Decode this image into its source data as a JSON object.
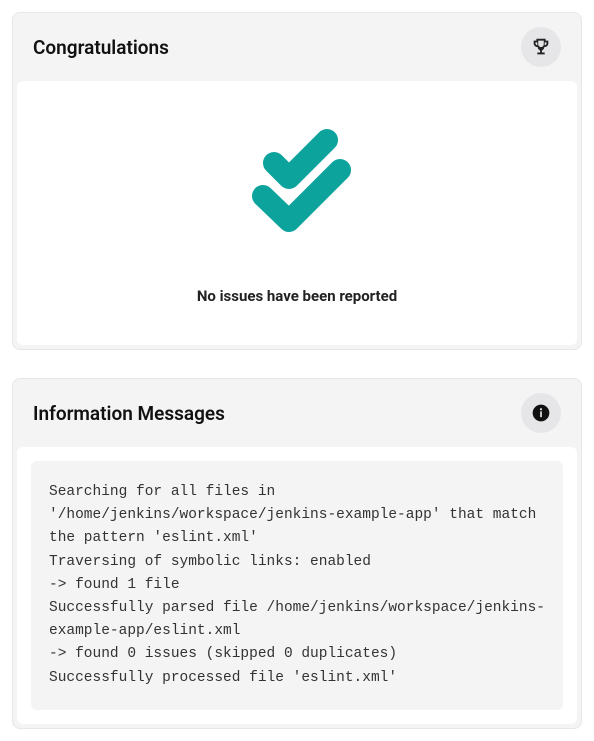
{
  "congrats": {
    "title": "Congratulations",
    "empty_text": "No issues have been reported"
  },
  "info": {
    "title": "Information Messages",
    "log": "Searching for all files in '/home/jenkins/workspace/jenkins-example-app' that match the pattern 'eslint.xml'\nTraversing of symbolic links: enabled\n-> found 1 file\nSuccessfully parsed file /home/jenkins/workspace/jenkins-example-app/eslint.xml\n-> found 0 issues (skipped 0 duplicates)\nSuccessfully processed file 'eslint.xml'"
  },
  "colors": {
    "check": "#0ba39c"
  },
  "icons": {
    "trophy": "trophy-icon",
    "info": "info-icon",
    "double_check": "double-check-icon"
  }
}
